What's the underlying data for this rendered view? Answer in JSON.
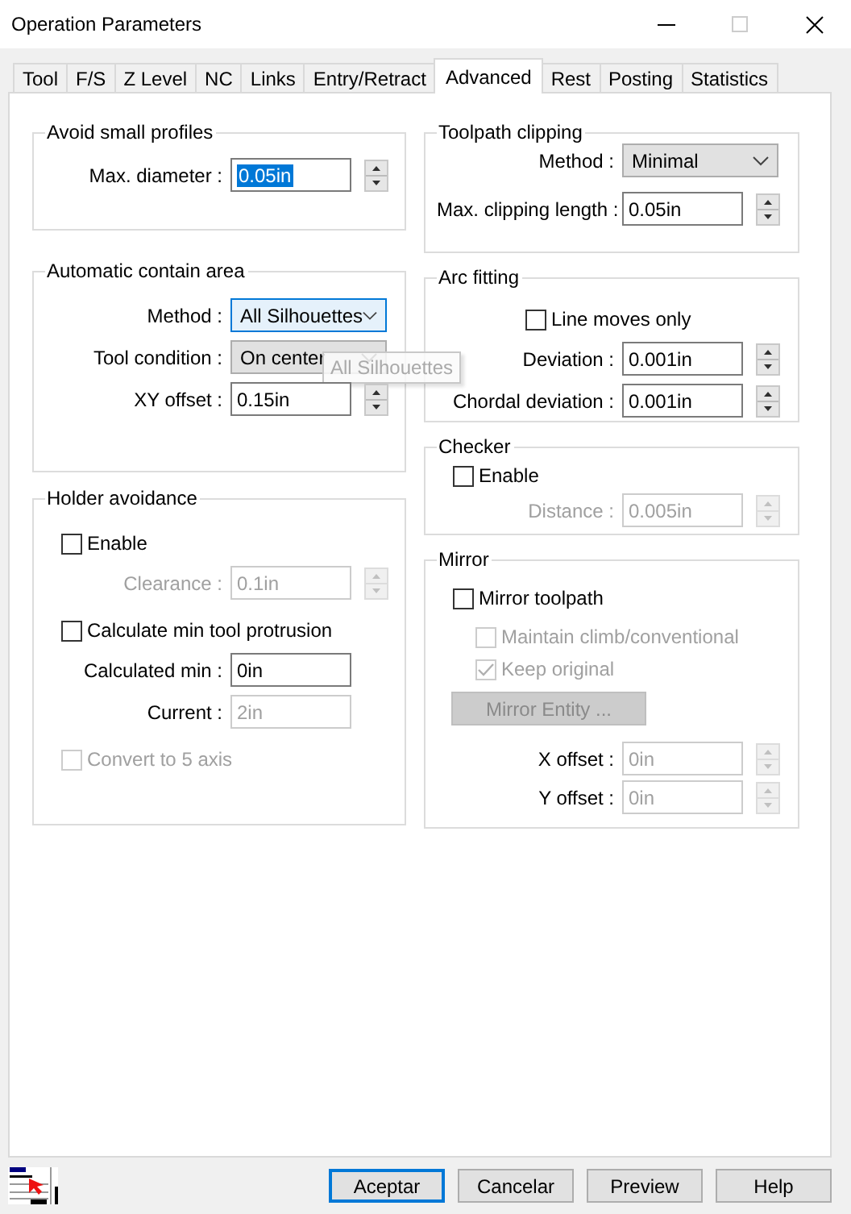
{
  "window": {
    "title": "Operation Parameters"
  },
  "tabs": [
    {
      "label": "Tool",
      "selected": false
    },
    {
      "label": "F/S",
      "selected": false
    },
    {
      "label": "Z Level",
      "selected": false
    },
    {
      "label": "NC",
      "selected": false
    },
    {
      "label": "Links",
      "selected": false
    },
    {
      "label": "Entry/Retract",
      "selected": false
    },
    {
      "label": "Advanced",
      "selected": true
    },
    {
      "label": "Rest",
      "selected": false
    },
    {
      "label": "Posting",
      "selected": false
    },
    {
      "label": "Statistics",
      "selected": false
    }
  ],
  "columns": [
    {
      "groups": [
        {
          "title": "Avoid small profiles",
          "rows": [
            {
              "kind": "spin",
              "label": "Max. diameter :",
              "value": "0.05in",
              "highlighted": true,
              "disabled": false,
              "label_disabled": false
            }
          ]
        },
        {
          "title": "Automatic contain area",
          "rows": [
            {
              "kind": "combo",
              "label": "Method :",
              "value": "All Silhouettes",
              "focused": true,
              "disabled": false
            },
            {
              "kind": "combo",
              "label": "Tool condition :",
              "value": "On center",
              "focused": false,
              "disabled": false,
              "tooltip": "All Silhouettes"
            },
            {
              "kind": "spin",
              "label": "XY offset :",
              "value": "0.15in",
              "highlighted": false,
              "disabled": false,
              "label_disabled": false
            }
          ]
        },
        {
          "title": "Holder avoidance",
          "rows": [
            {
              "kind": "checkbox",
              "label": "Enable",
              "checked": false,
              "disabled": false
            },
            {
              "kind": "spin",
              "label": "Clearance :",
              "value": "0.1in",
              "highlighted": false,
              "disabled": true,
              "label_disabled": true
            },
            {
              "kind": "checkbox",
              "label": "Calculate min tool protrusion",
              "checked": false,
              "disabled": false
            },
            {
              "kind": "field",
              "label": "Calculated min :",
              "value": "0in",
              "highlighted": false,
              "disabled": false,
              "label_disabled": false
            },
            {
              "kind": "field",
              "label": "Current :",
              "value": "2in",
              "highlighted": false,
              "disabled": true,
              "label_disabled": false
            },
            {
              "kind": "checkbox",
              "label": "Convert to 5 axis",
              "checked": false,
              "disabled": true
            }
          ]
        }
      ]
    },
    {
      "groups": [
        {
          "title": "Toolpath clipping",
          "rows": [
            {
              "kind": "combo",
              "label": "Method :",
              "value": "Minimal",
              "focused": false,
              "disabled": false
            },
            {
              "kind": "spin",
              "label": "Max. clipping length :",
              "value": "0.05in",
              "highlighted": false,
              "disabled": false,
              "label_disabled": false
            }
          ]
        },
        {
          "title": "Arc fitting",
          "rows": [
            {
              "kind": "checkbox",
              "label": "Line moves only",
              "checked": false,
              "disabled": false
            },
            {
              "kind": "spin",
              "label": "Deviation :",
              "value": "0.001in",
              "highlighted": false,
              "disabled": false,
              "label_disabled": false
            },
            {
              "kind": "spin",
              "label": "Chordal deviation :",
              "value": "0.001in",
              "highlighted": false,
              "disabled": false,
              "label_disabled": false
            }
          ]
        },
        {
          "title": "Checker",
          "rows": [
            {
              "kind": "checkbox",
              "label": "Enable",
              "checked": false,
              "disabled": false
            },
            {
              "kind": "spin",
              "label": "Distance :",
              "value": "0.005in",
              "highlighted": false,
              "disabled": true,
              "label_disabled": true
            }
          ]
        },
        {
          "title": "Mirror",
          "rows": [
            {
              "kind": "checkbox",
              "label": "Mirror toolpath",
              "checked": false,
              "disabled": false,
              "children": [
                {
                  "kind": "checkbox",
                  "label": "Maintain climb/conventional",
                  "checked": false,
                  "disabled": true
                },
                {
                  "kind": "checkbox",
                  "label": "Keep original",
                  "checked": true,
                  "disabled": true
                }
              ]
            },
            {
              "kind": "button",
              "label": "Mirror Entity ...",
              "disabled": true
            },
            {
              "kind": "spin",
              "label": "X offset :",
              "value": "0in",
              "highlighted": false,
              "disabled": true,
              "label_disabled": false
            },
            {
              "kind": "spin",
              "label": "Y offset :",
              "value": "0in",
              "highlighted": false,
              "disabled": true,
              "label_disabled": false
            }
          ]
        }
      ]
    }
  ],
  "buttons": [
    {
      "label": "Aceptar",
      "default": true
    },
    {
      "label": "Cancelar",
      "default": false
    },
    {
      "label": "Preview",
      "default": false
    },
    {
      "label": "Help",
      "default": false
    }
  ]
}
